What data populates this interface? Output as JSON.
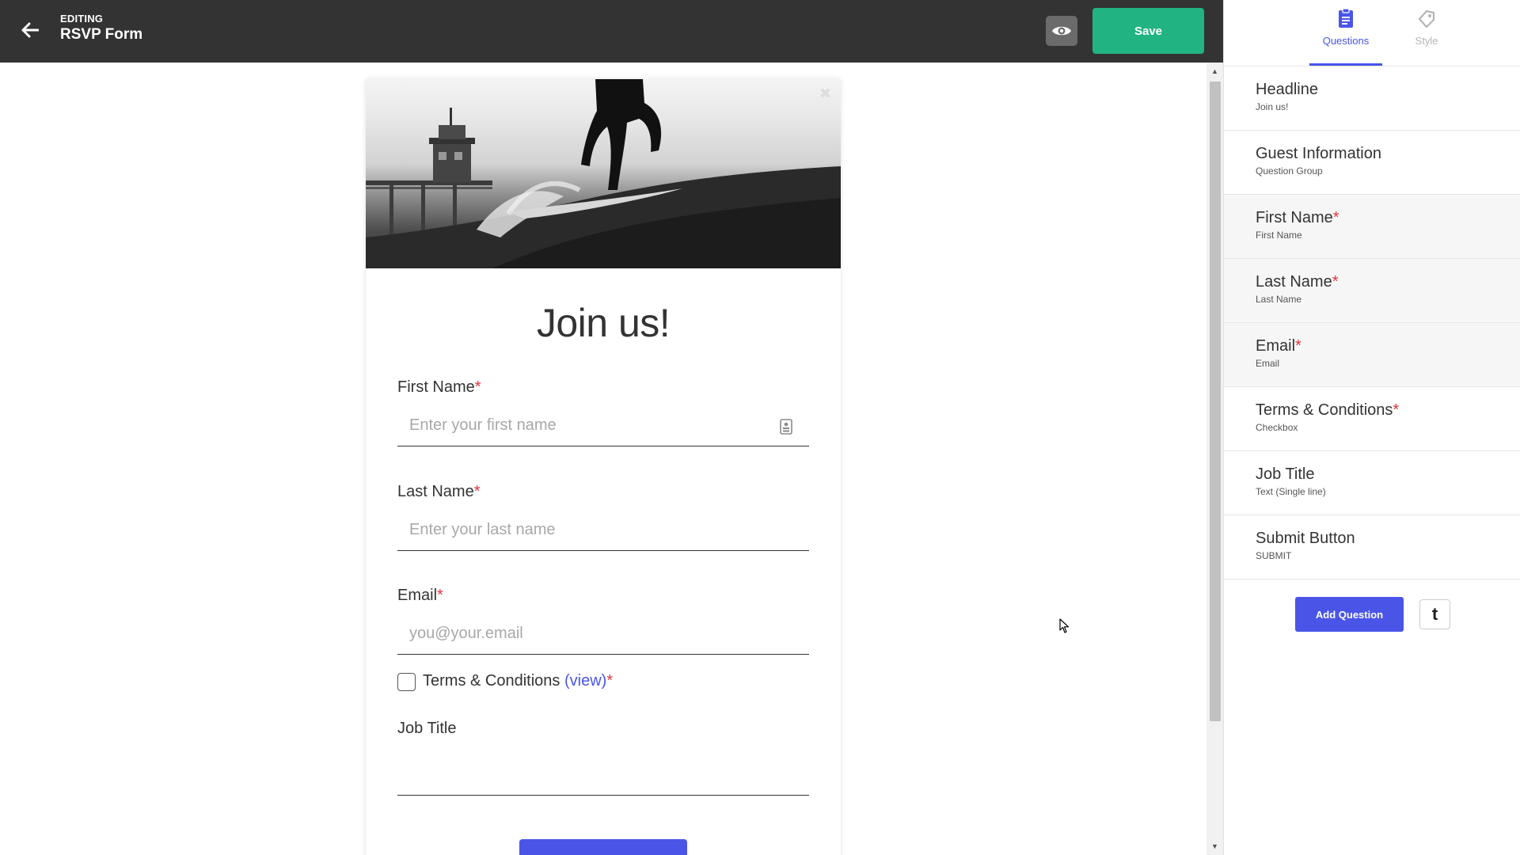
{
  "header": {
    "editing_label": "EDITING",
    "form_title": "RSVP Form",
    "save_label": "Save"
  },
  "form": {
    "headline": "Join us!",
    "fields": {
      "first_name": {
        "label": "First Name",
        "required": "*",
        "placeholder": "Enter your first name"
      },
      "last_name": {
        "label": "Last Name",
        "required": "*",
        "placeholder": "Enter your last name"
      },
      "email": {
        "label": "Email",
        "required": "*",
        "placeholder": "you@your.email"
      },
      "terms": {
        "label": "Terms & Conditions",
        "link": "(view)",
        "required": "*"
      },
      "job_title": {
        "label": "Job Title",
        "placeholder": ""
      }
    },
    "submit_label": "SUBMIT"
  },
  "panel": {
    "tabs": [
      {
        "label": "Questions",
        "icon": "clipboard-icon",
        "active": true
      },
      {
        "label": "Style",
        "icon": "paint-tag-icon",
        "active": false
      }
    ],
    "questions": [
      {
        "title": "Headline",
        "required": "",
        "sub": "Join us!"
      },
      {
        "title": "Guest Information",
        "required": "",
        "sub": "Question Group"
      },
      {
        "title": "First Name",
        "required": "*",
        "sub": "First Name"
      },
      {
        "title": "Last Name",
        "required": "*",
        "sub": "Last Name"
      },
      {
        "title": "Email",
        "required": "*",
        "sub": "Email"
      },
      {
        "title": "Terms & Conditions",
        "required": "*",
        "sub": "Checkbox"
      },
      {
        "title": "Job Title",
        "required": "",
        "sub": "Text (Single line)"
      },
      {
        "title": "Submit Button",
        "required": "",
        "sub": "SUBMIT"
      }
    ],
    "add_question_label": "Add Question",
    "typeform_button_label": "t"
  },
  "colors": {
    "topbar": "#333333",
    "save_green": "#22b383",
    "accent_blue": "#4a55e8",
    "required_red": "#e0343f"
  }
}
